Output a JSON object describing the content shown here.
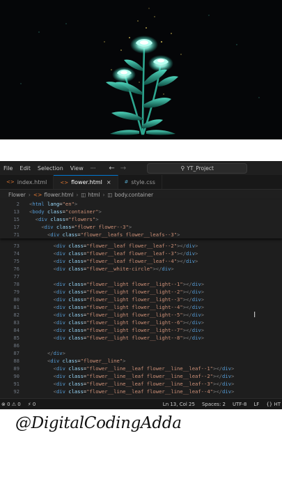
{
  "menubar": {
    "items": [
      "File",
      "Edit",
      "Selection",
      "View",
      "···"
    ],
    "back_icon": "arrow-left-icon",
    "forward_icon": "arrow-right-icon",
    "search_label": "YT_Project"
  },
  "tabs": [
    {
      "label": "index.html",
      "icon": "html-file-icon",
      "active": false
    },
    {
      "label": "flower.html",
      "icon": "html-file-icon",
      "active": true,
      "close": "×"
    },
    {
      "label": "style.css",
      "icon": "css-file-icon",
      "active": false
    }
  ],
  "breadcrumb": [
    "Flower",
    "flower.html",
    "html",
    "body.container"
  ],
  "sticky_lines": [
    {
      "num": "2",
      "text": "<html lang=\"en\">"
    },
    {
      "num": "13",
      "text": "<body class=\"container\">"
    },
    {
      "num": "15",
      "text": "  <div class=\"flowers\">"
    },
    {
      "num": "17",
      "text": "    <div class=\"flower flower--3\">"
    },
    {
      "num": "71",
      "text": "      <div class=\"flower__leafs flower__leafs--3\">"
    }
  ],
  "code_lines": [
    {
      "num": "73",
      "text": "        <div class=\"flower__leaf flower__leaf--2\"></div>"
    },
    {
      "num": "74",
      "text": "        <div class=\"flower__leaf flower__leaf--3\"></div>"
    },
    {
      "num": "75",
      "text": "        <div class=\"flower__leaf flower__leaf--4\"></div>"
    },
    {
      "num": "76",
      "text": "        <div class=\"flower__white-circle\"></div>"
    },
    {
      "num": "77",
      "text": ""
    },
    {
      "num": "78",
      "text": "        <div class=\"flower__light flower__light--1\"></div>"
    },
    {
      "num": "79",
      "text": "        <div class=\"flower__light flower__light--2\"></div>"
    },
    {
      "num": "80",
      "text": "        <div class=\"flower__light flower__light--3\"></div>"
    },
    {
      "num": "81",
      "text": "        <div class=\"flower__light flower__light--4\"></div>"
    },
    {
      "num": "82",
      "text": "        <div class=\"flower__light flower__light--5\"></div>"
    },
    {
      "num": "83",
      "text": "        <div class=\"flower__light flower__light--6\"></div>"
    },
    {
      "num": "84",
      "text": "        <div class=\"flower__light flower__light--7\"></div>"
    },
    {
      "num": "85",
      "text": "        <div class=\"flower__light flower__light--8\"></div>"
    },
    {
      "num": "86",
      "text": ""
    },
    {
      "num": "87",
      "text": "      </div>"
    },
    {
      "num": "88",
      "text": "      <div class=\"flower__line\">"
    },
    {
      "num": "89",
      "text": "        <div class=\"flower__line__leaf flower__line__leaf--1\"></div>"
    },
    {
      "num": "90",
      "text": "        <div class=\"flower__line__leaf flower__line__leaf--2\"></div>"
    },
    {
      "num": "91",
      "text": "        <div class=\"flower__line__leaf flower__line__leaf--3\"></div>"
    },
    {
      "num": "92",
      "text": "        <div class=\"flower__line__leaf flower__line__leaf--4\"></div>"
    }
  ],
  "statusbar": {
    "errors": "⊗ 0 ⚠ 0",
    "ports": "⚡ 0",
    "position": "Ln 13, Col 25",
    "spaces": "Spaces: 2",
    "encoding": "UTF-8",
    "eol": "LF",
    "language": "{} HT"
  },
  "watermark": "@DigitalCodingAdda",
  "colors": {
    "tag": "#569cd6",
    "attr": "#9cdcfe",
    "string": "#ce9178",
    "punct": "#808080",
    "glow": "#8ff5e2",
    "leaf": "#1f8f7c"
  }
}
